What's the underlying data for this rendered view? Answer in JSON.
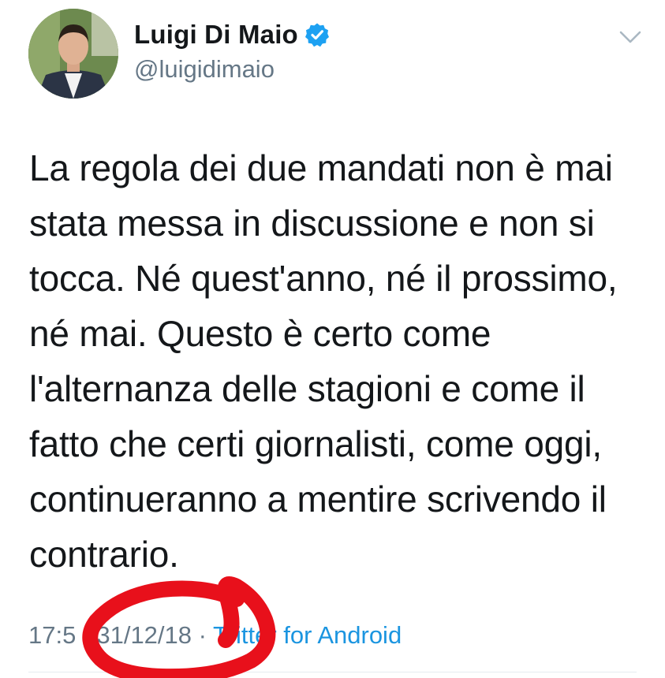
{
  "author": {
    "display_name": "Luigi Di Maio",
    "handle": "@luigidimaio",
    "verified": true,
    "verified_icon": "verified-badge-icon",
    "avatar": "profile-photo"
  },
  "menu": {
    "icon": "chevron-down-icon"
  },
  "tweet": {
    "text": "La regola dei due mandati non è mai\nstata messa in discussione e non si\ntocca. Né quest'anno, né il prossimo,\nné mai. Questo è certo come\nl'alternanza delle stagioni e come il\nfatto che certi giornalisti, come oggi,\ncontinueranno a mentire scrivendo il\ncontrario.",
    "time": "17:50",
    "separator": "·",
    "date": "31/12/18",
    "source": "Twitter for Android",
    "time_visible": "17:5",
    "source_visible": "itter for Android",
    "source_prefix_visible": "T"
  },
  "colors": {
    "text": "#14171a",
    "secondary": "#657786",
    "link": "#1b95e0",
    "verified": "#1da1f2",
    "annotation": "#e8101b"
  }
}
